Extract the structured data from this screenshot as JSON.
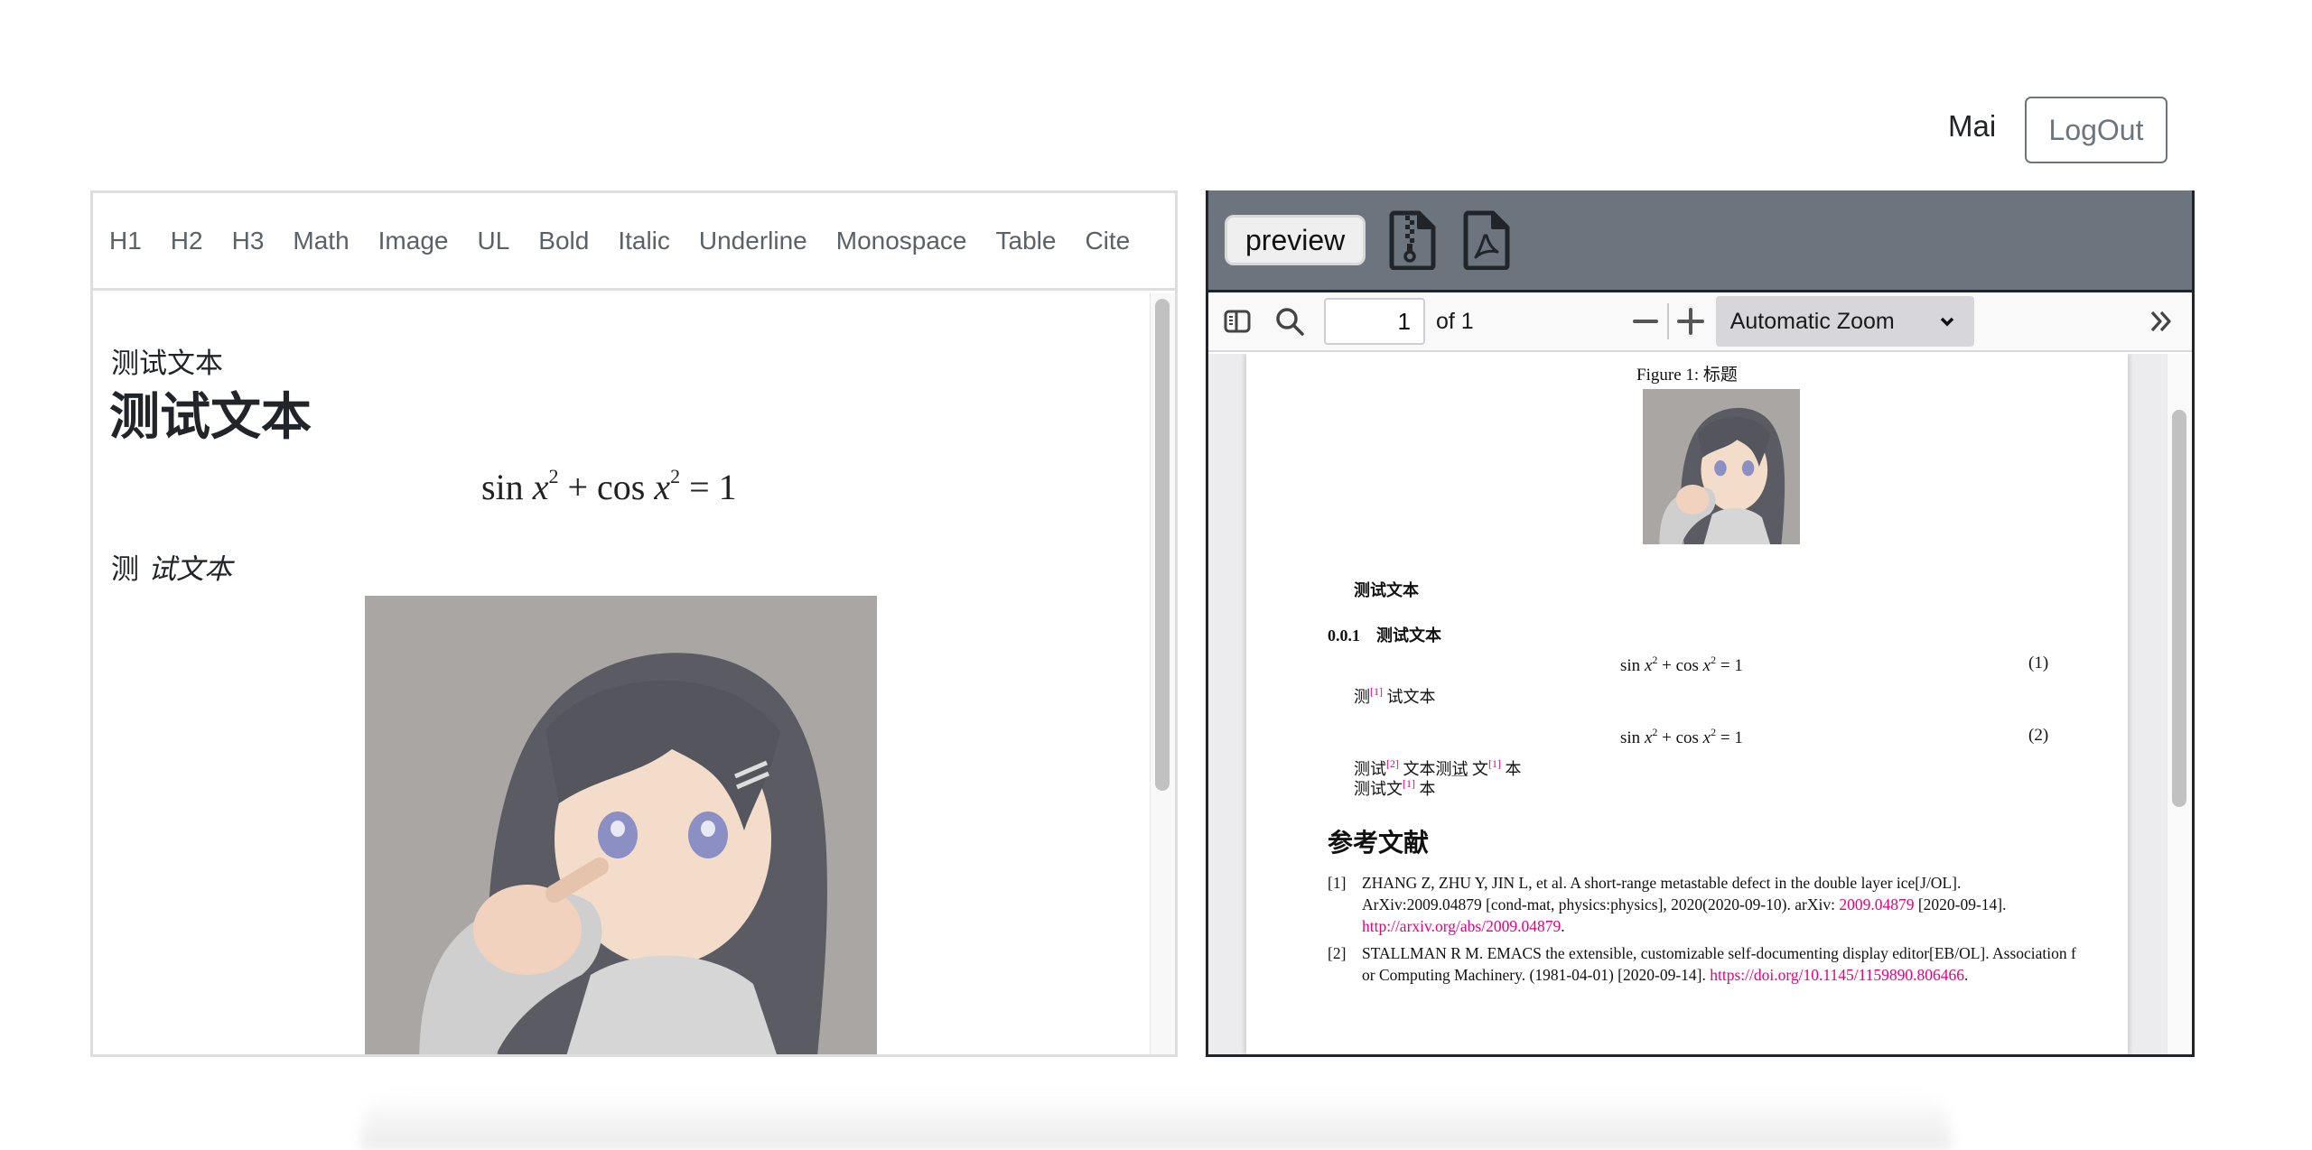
{
  "header": {
    "user_name": "Mai",
    "logout_label": "LogOut"
  },
  "editor": {
    "toolbar": [
      "H1",
      "H2",
      "H3",
      "Math",
      "Image",
      "UL",
      "Bold",
      "Italic",
      "Underline",
      "Monospace",
      "Table",
      "Cite"
    ],
    "content": {
      "heading_small": "测试文本",
      "heading_large": "测试文本",
      "math": {
        "fn1": "sin",
        "var": "x",
        "exp": "2",
        "plus": "+",
        "fn2": "cos",
        "eq": "=",
        "rhs": "1"
      },
      "para_first": "测",
      "para_italic": "试文本",
      "image_alt": "anime girl pointing"
    }
  },
  "preview": {
    "preview_label": "preview",
    "icons": [
      "zip-file-icon",
      "pdf-file-icon"
    ],
    "pdf_toolbar": {
      "page_number": "1",
      "page_of": "of 1",
      "zoom_option": "Automatic Zoom"
    },
    "pdf": {
      "figure_caption": "Figure 1: 标题",
      "para1": "测试文本",
      "section_number": "0.0.1",
      "section_title": "测试文本",
      "equations": [
        {
          "fn1": "sin",
          "var": "x",
          "exp": "2",
          "plus": "+",
          "fn2": "cos",
          "eq": "=",
          "rhs": "1",
          "number": "(1)"
        },
        {
          "fn1": "sin",
          "var": "x",
          "exp": "2",
          "plus": "+",
          "fn2": "cos",
          "eq": "=",
          "rhs": "1",
          "number": "(2)"
        }
      ],
      "line_after_eq1": {
        "a": "测",
        "cite": "[1]",
        "b": " 试文本"
      },
      "line_after_eq2a": {
        "a": "测试",
        "cite1": "[2]",
        "b": " 文本测",
        "u": "试",
        "c": " 文",
        "cite2": "[1]",
        "d": " 本"
      },
      "line_after_eq2b": {
        "a": "测试文",
        "cite": "[1]",
        "b": " 本"
      },
      "references_title": "参考文献",
      "references": [
        {
          "num": "[1]",
          "text": "ZHANG Z, ZHU Y, JIN L, et al. A short-range metastable defect in the double layer ice[J/OL]. ArXiv:2009.04879 [cond-mat, physics:physics], 2020(2020-09-10). arXiv: ",
          "link1": "2009.04879",
          "text2": " [2020-09-14]. ",
          "link2": "http://arxiv.org/abs/2009.04879",
          "end": "."
        },
        {
          "num": "[2]",
          "text": "STALLMAN R M. EMACS the extensible, customizable self-documenting display editor[EB/OL]. Association for Computing Machinery. (1981-04-01) [2020-09-14]. ",
          "link1": "https://doi.org/10.1145/1159890.806466",
          "end": "."
        }
      ]
    }
  },
  "colors": {
    "preview_bar": "#6c757d",
    "citation_link": "#e6007e",
    "toolbar_text": "#5a6169"
  }
}
